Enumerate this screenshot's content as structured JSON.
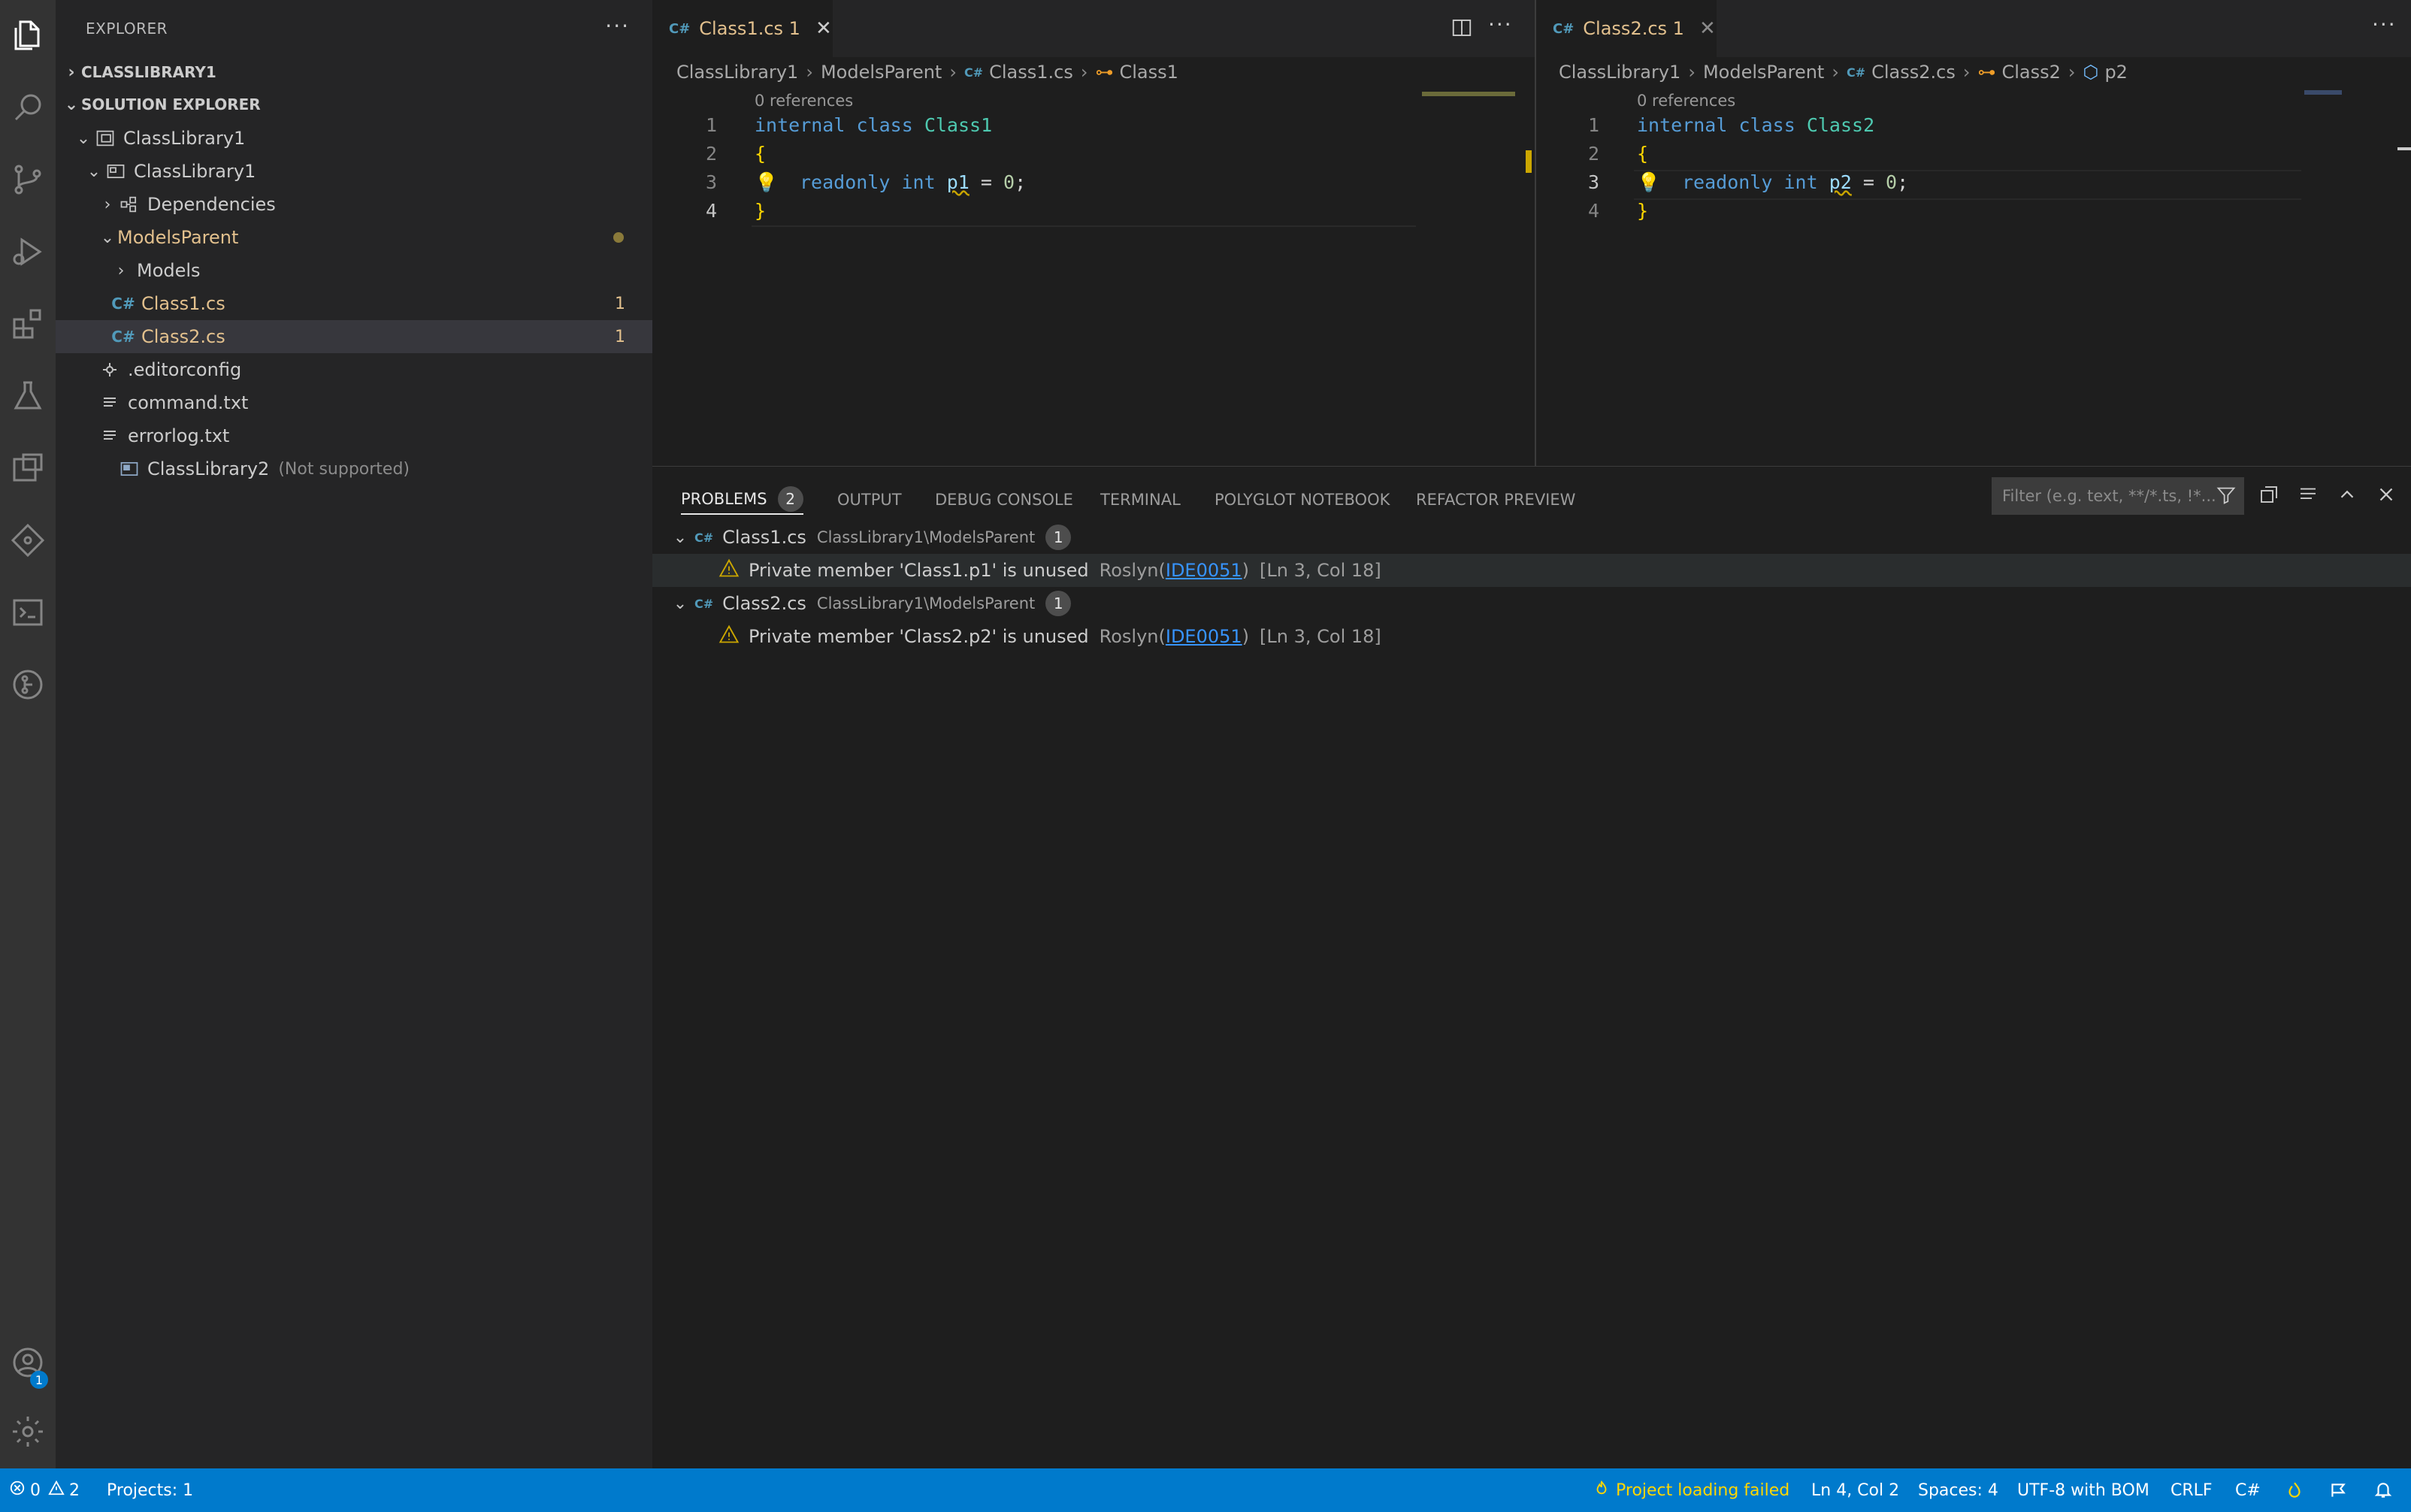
{
  "sidebar": {
    "title": "EXPLORER",
    "more": "···",
    "folder_section": "CLASSLIBRARY1",
    "solution_section": "SOLUTION EXPLORER",
    "items": [
      {
        "label": "ClassLibrary1",
        "icon": "solution-icon"
      },
      {
        "label": "ClassLibrary1",
        "icon": "csproj-icon"
      },
      {
        "label": "Dependencies",
        "icon": "dependencies-icon"
      },
      {
        "label": "ModelsParent",
        "icon": "folder"
      },
      {
        "label": "Models",
        "icon": "folder"
      },
      {
        "label": "Class1.cs",
        "icon": "csharp-file-icon",
        "badge": "1"
      },
      {
        "label": "Class2.cs",
        "icon": "csharp-file-icon",
        "badge": "1"
      },
      {
        "label": ".editorconfig",
        "icon": "gear-file-icon"
      },
      {
        "label": "command.txt",
        "icon": "text-file-icon"
      },
      {
        "label": "errorlog.txt",
        "icon": "text-file-icon"
      },
      {
        "label": "ClassLibrary2",
        "icon": "vb-project-icon",
        "note": "(Not supported)"
      }
    ]
  },
  "editor1": {
    "tab_label": "Class1.cs 1",
    "close": "✕",
    "breadcrumb": [
      "ClassLibrary1",
      "ModelsParent",
      "Class1.cs",
      "Class1"
    ],
    "codelens": "0 references",
    "lines": [
      "1",
      "2",
      "3",
      "4"
    ],
    "code": {
      "internal": "internal",
      "class": "class",
      "name": "Class1",
      "open": "{",
      "readonly": "readonly",
      "int": "int",
      "field": "p1",
      "eq": "=",
      "value": "0",
      "semi": ";",
      "close": "}"
    }
  },
  "editor2": {
    "tab_label": "Class2.cs 1",
    "close": "✕",
    "breadcrumb": [
      "ClassLibrary1",
      "ModelsParent",
      "Class2.cs",
      "Class2",
      "p2"
    ],
    "codelens": "0 references",
    "lines": [
      "1",
      "2",
      "3",
      "4"
    ],
    "code": {
      "internal": "internal",
      "class": "class",
      "name": "Class2",
      "open": "{",
      "readonly": "readonly",
      "int": "int",
      "field": "p2",
      "eq": "=",
      "value": "0",
      "semi": ";",
      "close": "}"
    }
  },
  "panel": {
    "tabs": [
      "PROBLEMS",
      "OUTPUT",
      "DEBUG CONSOLE",
      "TERMINAL",
      "POLYGLOT NOTEBOOK",
      "REFACTOR PREVIEW"
    ],
    "problems_count": "2",
    "filter_placeholder": "Filter (e.g. text, **/*.ts, !*...",
    "groups": [
      {
        "file": "Class1.cs",
        "path": "ClassLibrary1\\ModelsParent",
        "count": "1",
        "message": "Private member 'Class1.p1' is unused",
        "source": "Roslyn(",
        "code": "IDE0051",
        "source_end": ")",
        "location": "[Ln 3, Col 18]"
      },
      {
        "file": "Class2.cs",
        "path": "ClassLibrary1\\ModelsParent",
        "count": "1",
        "message": "Private member 'Class2.p2' is unused",
        "source": "Roslyn(",
        "code": "IDE0051",
        "source_end": ")",
        "location": "[Ln 3, Col 18]"
      }
    ]
  },
  "status": {
    "errors": "0",
    "warnings": "2",
    "projects": "Projects: 1",
    "project_loading": "Project loading failed",
    "cursor": "Ln 4, Col 2",
    "spaces": "Spaces: 4",
    "encoding": "UTF-8 with BOM",
    "eol": "CRLF",
    "language": "C#"
  },
  "accounts_badge": "1",
  "colors": {
    "status_bar": "#007acc",
    "modified": "#e2c08d",
    "warning": "#cca700",
    "link": "#3794ff"
  }
}
